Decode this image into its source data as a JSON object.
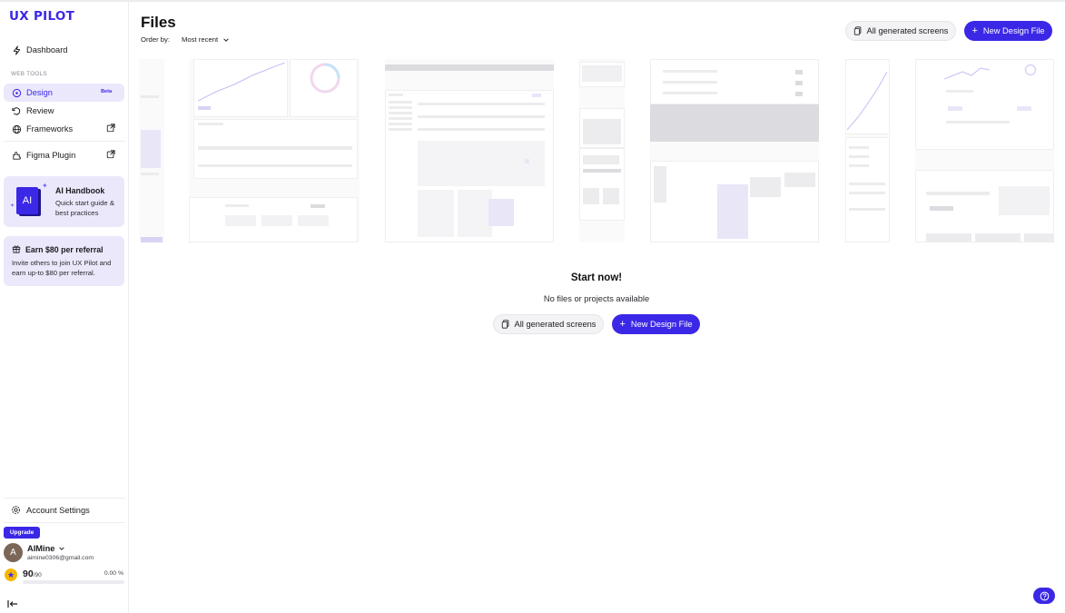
{
  "app": {
    "logo": "UX PILOT"
  },
  "sidebar": {
    "dashboard": "Dashboard",
    "section_label": "WEB TOOLS",
    "design": "Design",
    "design_badge": "Beta",
    "review": "Review",
    "frameworks": "Frameworks",
    "figma_plugin": "Figma Plugin",
    "handbook": {
      "title": "AI Handbook",
      "subtitle": "Quick start guide & best practices",
      "book_label": "AI"
    },
    "referral": {
      "title": "Earn $80 per referral",
      "subtitle": "Invite others to join UX Pilot and earn up-to $80 per referral."
    },
    "account_settings": "Account Settings",
    "upgrade": "Upgrade",
    "user": {
      "initial": "A",
      "name": "AIMine",
      "email": "aimine0306@gmail.com"
    },
    "credits": {
      "value": "90",
      "max": "/90",
      "percent": "0.00 %",
      "progress": 0
    }
  },
  "main": {
    "title": "Files",
    "order_by_label": "Order by:",
    "order_by_value": "Most recent",
    "all_generated": "All generated screens",
    "new_design": "New Design File",
    "empty_title": "Start now!",
    "empty_text": "No files or projects available"
  },
  "colors": {
    "accent": "#3b28e6",
    "accent_soft": "#ebe8fb"
  }
}
